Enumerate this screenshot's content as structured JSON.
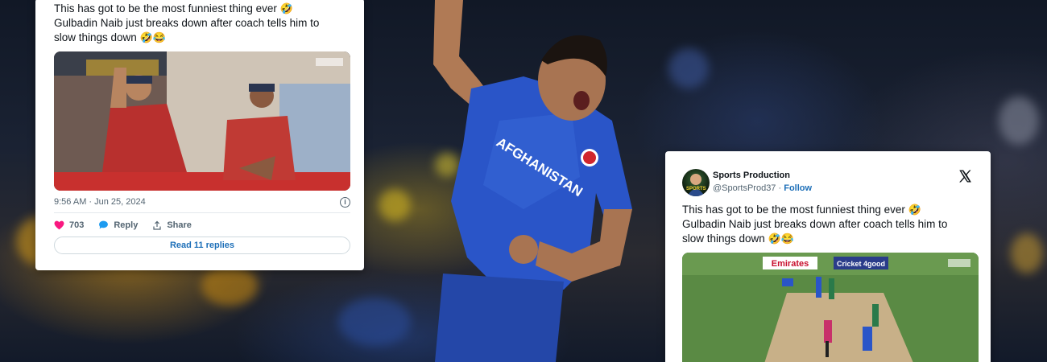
{
  "left_tweet": {
    "text_line1": "This has got to be the most funniest thing ever",
    "text_line2": "Gulbadin Naib just breaks down after coach tells him to",
    "text_line3": "slow things down",
    "emoji_1": "🤣",
    "emoji_2": "🤣😂",
    "timestamp": "9:56 AM · Jun 25, 2024",
    "like_count": "703",
    "reply_label": "Reply",
    "share_label": "Share",
    "read_replies_label": "Read 11 replies",
    "icons": [
      "heart-icon",
      "reply-bubble-icon",
      "share-icon",
      "info-icon",
      "video-thumbnail"
    ]
  },
  "right_tweet": {
    "display_name": "Sports Production",
    "handle": "@SportsProd37",
    "separator": " · ",
    "follow_label": "Follow",
    "avatar_label": "SPORTS",
    "text_line1": "This has got to be the most funniest thing ever",
    "text_line2": "Gulbadin Naib just breaks down after coach tells him to",
    "text_line3": "slow things down",
    "emoji_1": "🤣",
    "emoji_2": "🤣😂",
    "video_sign_left": "Emirates",
    "video_sign_right": "Cricket 4good",
    "icons": [
      "x-logo-icon",
      "avatar",
      "video-thumbnail"
    ]
  },
  "background": {
    "jersey_text": "AFGHANISTAN"
  },
  "colors": {
    "jersey_blue": "#2a55c8",
    "like_pink": "#f91880",
    "link_blue": "#1d6fb8",
    "text_dark": "#0f1419",
    "text_muted": "#536471"
  }
}
